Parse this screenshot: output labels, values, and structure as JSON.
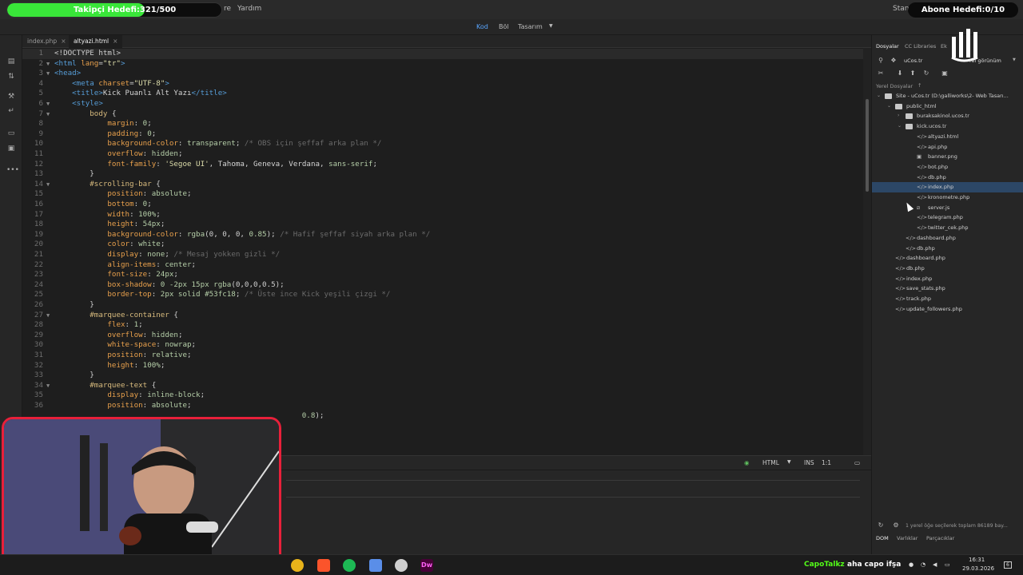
{
  "menubar": {
    "visible_items": [
      "re",
      "Yardım"
    ],
    "workspace_label": "Stand"
  },
  "overlays": {
    "followers_goal": {
      "label": "Takipçi Hedefi:321/500",
      "current": 321,
      "target": 500,
      "color": "#39e639"
    },
    "subs_goal": {
      "label": "Abone Hedefi:0/10",
      "current": 0,
      "target": 10
    }
  },
  "toolbar": {
    "views": [
      "Kod",
      "Böl",
      "Tasarım"
    ],
    "active_view": "Kod"
  },
  "tabs": [
    {
      "label": "index.php",
      "active": false
    },
    {
      "label": "altyazi.html",
      "active": true
    }
  ],
  "editor": {
    "current_line": 1,
    "lines": [
      {
        "n": "1",
        "fold": "",
        "tokens": [
          [
            "pun",
            "<!DOCTYPE html>"
          ]
        ]
      },
      {
        "n": "2",
        "fold": "▼",
        "tokens": [
          [
            "tag",
            "<html "
          ],
          [
            "prop",
            "lang"
          ],
          [
            "pun",
            "="
          ],
          [
            "str",
            "\"tr\""
          ],
          [
            "tag",
            ">"
          ]
        ]
      },
      {
        "n": "3",
        "fold": "▼",
        "tokens": [
          [
            "tag",
            "<head>"
          ]
        ]
      },
      {
        "n": "4",
        "fold": "",
        "tokens": [
          [
            "txt",
            "    "
          ],
          [
            "tag",
            "<meta "
          ],
          [
            "prop",
            "charset"
          ],
          [
            "pun",
            "="
          ],
          [
            "str",
            "\"UTF-8\""
          ],
          [
            "tag",
            ">"
          ]
        ]
      },
      {
        "n": "5",
        "fold": "",
        "tokens": [
          [
            "txt",
            "    "
          ],
          [
            "tag",
            "<title>"
          ],
          [
            "txt",
            "Kick Puanlı Alt Yazı"
          ],
          [
            "tag",
            "</title>"
          ]
        ]
      },
      {
        "n": "6",
        "fold": "▼",
        "tokens": [
          [
            "txt",
            "    "
          ],
          [
            "tag",
            "<style>"
          ]
        ]
      },
      {
        "n": "7",
        "fold": "▼",
        "tokens": [
          [
            "txt",
            "        "
          ],
          [
            "sel",
            "body"
          ],
          [
            "pun",
            " {"
          ]
        ]
      },
      {
        "n": "8",
        "fold": "",
        "tokens": [
          [
            "txt",
            "            "
          ],
          [
            "prop",
            "margin"
          ],
          [
            "pun",
            ": "
          ],
          [
            "val",
            "0"
          ],
          [
            "pun",
            ";"
          ]
        ]
      },
      {
        "n": "9",
        "fold": "",
        "tokens": [
          [
            "txt",
            "            "
          ],
          [
            "prop",
            "padding"
          ],
          [
            "pun",
            ": "
          ],
          [
            "val",
            "0"
          ],
          [
            "pun",
            ";"
          ]
        ]
      },
      {
        "n": "10",
        "fold": "",
        "tokens": [
          [
            "txt",
            "            "
          ],
          [
            "prop",
            "background-color"
          ],
          [
            "pun",
            ": "
          ],
          [
            "val",
            "transparent"
          ],
          [
            "pun",
            "; "
          ],
          [
            "cmt",
            "/* OBS için şeffaf arka plan */"
          ]
        ]
      },
      {
        "n": "11",
        "fold": "",
        "tokens": [
          [
            "txt",
            "            "
          ],
          [
            "prop",
            "overflow"
          ],
          [
            "pun",
            ": "
          ],
          [
            "val",
            "hidden"
          ],
          [
            "pun",
            ";"
          ]
        ]
      },
      {
        "n": "12",
        "fold": "",
        "tokens": [
          [
            "txt",
            "            "
          ],
          [
            "prop",
            "font-family"
          ],
          [
            "pun",
            ": "
          ],
          [
            "str",
            "'Segoe UI'"
          ],
          [
            "pun",
            ", "
          ],
          [
            "txt",
            "Tahoma"
          ],
          [
            "pun",
            ", "
          ],
          [
            "txt",
            "Geneva"
          ],
          [
            "pun",
            ", "
          ],
          [
            "txt",
            "Verdana"
          ],
          [
            "pun",
            ", "
          ],
          [
            "val",
            "sans-serif"
          ],
          [
            "pun",
            ";"
          ]
        ]
      },
      {
        "n": "13",
        "fold": "",
        "tokens": [
          [
            "txt",
            "        "
          ],
          [
            "pun",
            "}"
          ]
        ]
      },
      {
        "n": "14",
        "fold": "▼",
        "tokens": [
          [
            "txt",
            "        "
          ],
          [
            "sel",
            "#scrolling-bar"
          ],
          [
            "pun",
            " {"
          ]
        ]
      },
      {
        "n": "15",
        "fold": "",
        "tokens": [
          [
            "txt",
            "            "
          ],
          [
            "prop",
            "position"
          ],
          [
            "pun",
            ": "
          ],
          [
            "val",
            "absolute"
          ],
          [
            "pun",
            ";"
          ]
        ]
      },
      {
        "n": "16",
        "fold": "",
        "tokens": [
          [
            "txt",
            "            "
          ],
          [
            "prop",
            "bottom"
          ],
          [
            "pun",
            ": "
          ],
          [
            "val",
            "0"
          ],
          [
            "pun",
            ";"
          ]
        ]
      },
      {
        "n": "17",
        "fold": "",
        "tokens": [
          [
            "txt",
            "            "
          ],
          [
            "prop",
            "width"
          ],
          [
            "pun",
            ": "
          ],
          [
            "val",
            "100%"
          ],
          [
            "pun",
            ";"
          ]
        ]
      },
      {
        "n": "18",
        "fold": "",
        "tokens": [
          [
            "txt",
            "            "
          ],
          [
            "prop",
            "height"
          ],
          [
            "pun",
            ": "
          ],
          [
            "val",
            "54px"
          ],
          [
            "pun",
            ";"
          ]
        ]
      },
      {
        "n": "19",
        "fold": "",
        "tokens": [
          [
            "txt",
            "            "
          ],
          [
            "prop",
            "background-color"
          ],
          [
            "pun",
            ": "
          ],
          [
            "val",
            "rgba"
          ],
          [
            "pun",
            "(0, 0, 0, "
          ],
          [
            "val",
            "0.85"
          ],
          [
            "pun",
            "); "
          ],
          [
            "cmt",
            "/* Hafif şeffaf siyah arka plan */"
          ]
        ]
      },
      {
        "n": "20",
        "fold": "",
        "tokens": [
          [
            "txt",
            "            "
          ],
          [
            "prop",
            "color"
          ],
          [
            "pun",
            ": "
          ],
          [
            "val",
            "white"
          ],
          [
            "pun",
            ";"
          ]
        ]
      },
      {
        "n": "21",
        "fold": "",
        "tokens": [
          [
            "txt",
            "            "
          ],
          [
            "prop",
            "display"
          ],
          [
            "pun",
            ": "
          ],
          [
            "val",
            "none"
          ],
          [
            "pun",
            "; "
          ],
          [
            "cmt",
            "/* Mesaj yokken gizli */"
          ]
        ]
      },
      {
        "n": "22",
        "fold": "",
        "tokens": [
          [
            "txt",
            "            "
          ],
          [
            "prop",
            "align-items"
          ],
          [
            "pun",
            ": "
          ],
          [
            "val",
            "center"
          ],
          [
            "pun",
            ";"
          ]
        ]
      },
      {
        "n": "23",
        "fold": "",
        "tokens": [
          [
            "txt",
            "            "
          ],
          [
            "prop",
            "font-size"
          ],
          [
            "pun",
            ": "
          ],
          [
            "val",
            "24px"
          ],
          [
            "pun",
            ";"
          ]
        ]
      },
      {
        "n": "24",
        "fold": "",
        "tokens": [
          [
            "txt",
            "            "
          ],
          [
            "prop",
            "box-shadow"
          ],
          [
            "pun",
            ": "
          ],
          [
            "val",
            "0 -2px 15px rgba"
          ],
          [
            "pun",
            "(0,0,0,0.5);"
          ]
        ]
      },
      {
        "n": "25",
        "fold": "",
        "tokens": [
          [
            "txt",
            "            "
          ],
          [
            "prop",
            "border-top"
          ],
          [
            "pun",
            ": "
          ],
          [
            "val",
            "2px solid #53fc18"
          ],
          [
            "pun",
            "; "
          ],
          [
            "cmt",
            "/* Üste ince Kick yeşili çizgi */"
          ]
        ]
      },
      {
        "n": "26",
        "fold": "",
        "tokens": [
          [
            "txt",
            "        "
          ],
          [
            "pun",
            "}"
          ]
        ]
      },
      {
        "n": "27",
        "fold": "▼",
        "tokens": [
          [
            "txt",
            "        "
          ],
          [
            "sel",
            "#marquee-container"
          ],
          [
            "pun",
            " {"
          ]
        ]
      },
      {
        "n": "28",
        "fold": "",
        "tokens": [
          [
            "txt",
            "            "
          ],
          [
            "prop",
            "flex"
          ],
          [
            "pun",
            ": "
          ],
          [
            "val",
            "1"
          ],
          [
            "pun",
            ";"
          ]
        ]
      },
      {
        "n": "29",
        "fold": "",
        "tokens": [
          [
            "txt",
            "            "
          ],
          [
            "prop",
            "overflow"
          ],
          [
            "pun",
            ": "
          ],
          [
            "val",
            "hidden"
          ],
          [
            "pun",
            ";"
          ]
        ]
      },
      {
        "n": "30",
        "fold": "",
        "tokens": [
          [
            "txt",
            "            "
          ],
          [
            "prop",
            "white-space"
          ],
          [
            "pun",
            ": "
          ],
          [
            "val",
            "nowrap"
          ],
          [
            "pun",
            ";"
          ]
        ]
      },
      {
        "n": "31",
        "fold": "",
        "tokens": [
          [
            "txt",
            "            "
          ],
          [
            "prop",
            "position"
          ],
          [
            "pun",
            ": "
          ],
          [
            "val",
            "relative"
          ],
          [
            "pun",
            ";"
          ]
        ]
      },
      {
        "n": "32",
        "fold": "",
        "tokens": [
          [
            "txt",
            "            "
          ],
          [
            "prop",
            "height"
          ],
          [
            "pun",
            ": "
          ],
          [
            "val",
            "100%"
          ],
          [
            "pun",
            ";"
          ]
        ]
      },
      {
        "n": "33",
        "fold": "",
        "tokens": [
          [
            "txt",
            "        "
          ],
          [
            "pun",
            "}"
          ]
        ]
      },
      {
        "n": "34",
        "fold": "▼",
        "tokens": [
          [
            "txt",
            "        "
          ],
          [
            "sel",
            "#marquee-text"
          ],
          [
            "pun",
            " {"
          ]
        ]
      },
      {
        "n": "35",
        "fold": "",
        "tokens": [
          [
            "txt",
            "            "
          ],
          [
            "prop",
            "display"
          ],
          [
            "pun",
            ": "
          ],
          [
            "val",
            "inline-block"
          ],
          [
            "pun",
            ";"
          ]
        ]
      },
      {
        "n": "36",
        "fold": "",
        "tokens": [
          [
            "txt",
            "            "
          ],
          [
            "prop",
            "position"
          ],
          [
            "pun",
            ": "
          ],
          [
            "val",
            "absolute"
          ],
          [
            "pun",
            ";"
          ]
        ]
      },
      {
        "n": "",
        "fold": "",
        "tokens": [
          [
            "txt",
            "                                                        "
          ],
          [
            "val",
            "0.8"
          ],
          [
            "pun",
            ");"
          ]
        ]
      }
    ]
  },
  "statusbar": {
    "language": "HTML",
    "mode": "INS",
    "position": "1:1"
  },
  "right_panel": {
    "tabs": [
      "Dosyalar",
      "CC Libraries",
      "Ek"
    ],
    "active_tab": "Dosyalar",
    "site_select": "uCos.tr",
    "view_select": "rel görünüm",
    "section_label": "Yerel Dosyalar",
    "tree": [
      {
        "name": "Site - uCos.tr (D:\\galliworks\\2- Web Tasarı...",
        "depth": 0,
        "type": "site",
        "expanded": true
      },
      {
        "name": "public_html",
        "depth": 1,
        "type": "folder",
        "expanded": true
      },
      {
        "name": "buraksakinol.ucos.tr",
        "depth": 2,
        "type": "folder",
        "expanded": false
      },
      {
        "name": "kick.ucos.tr",
        "depth": 2,
        "type": "folder",
        "expanded": true
      },
      {
        "name": "altyazi.html",
        "depth": 3,
        "type": "code"
      },
      {
        "name": "api.php",
        "depth": 3,
        "type": "code"
      },
      {
        "name": "banner.png",
        "depth": 3,
        "type": "image"
      },
      {
        "name": "bot.php",
        "depth": 3,
        "type": "code"
      },
      {
        "name": "db.php",
        "depth": 3,
        "type": "code"
      },
      {
        "name": "index.php",
        "depth": 3,
        "type": "code",
        "selected": true
      },
      {
        "name": "kronometre.php",
        "depth": 3,
        "type": "code"
      },
      {
        "name": "server.js",
        "depth": 3,
        "type": "js"
      },
      {
        "name": "telegram.php",
        "depth": 3,
        "type": "code"
      },
      {
        "name": "twitter_cek.php",
        "depth": 3,
        "type": "code"
      },
      {
        "name": "dashboard.php",
        "depth": 2,
        "type": "code"
      },
      {
        "name": "db.php",
        "depth": 2,
        "type": "code"
      },
      {
        "name": "dashboard.php",
        "depth": 1,
        "type": "code"
      },
      {
        "name": "db.php",
        "depth": 1,
        "type": "code"
      },
      {
        "name": "index.php",
        "depth": 1,
        "type": "code"
      },
      {
        "name": "save_stats.php",
        "depth": 1,
        "type": "code"
      },
      {
        "name": "track.php",
        "depth": 1,
        "type": "code"
      },
      {
        "name": "update_followers.php",
        "depth": 1,
        "type": "code"
      }
    ],
    "footer_text": "1 yerel öğe seçilerek toplam 86189 bay...",
    "bottom_tabs": [
      "DOM",
      "Varlıklar",
      "Parçacıklar"
    ],
    "active_bottom_tab": "DOM"
  },
  "taskbar": {
    "apps": [
      {
        "name": "chrome-icon",
        "color": "#e8b31a"
      },
      {
        "name": "brave-icon",
        "color": "#fb542b"
      },
      {
        "name": "spotify-icon",
        "color": "#1db954"
      },
      {
        "name": "file-explorer-icon",
        "color": "#5a8ee8"
      },
      {
        "name": "obs-icon",
        "color": "#cfcfcf"
      },
      {
        "name": "dreamweaver-icon",
        "color": "#470137"
      }
    ],
    "dreamweaver_label": "Dw",
    "now_playing_user": "CapoTalkz",
    "now_playing_text": "aha capo ifşa",
    "time": "16:31",
    "date": "29.03.2026",
    "notification_count": "6"
  }
}
